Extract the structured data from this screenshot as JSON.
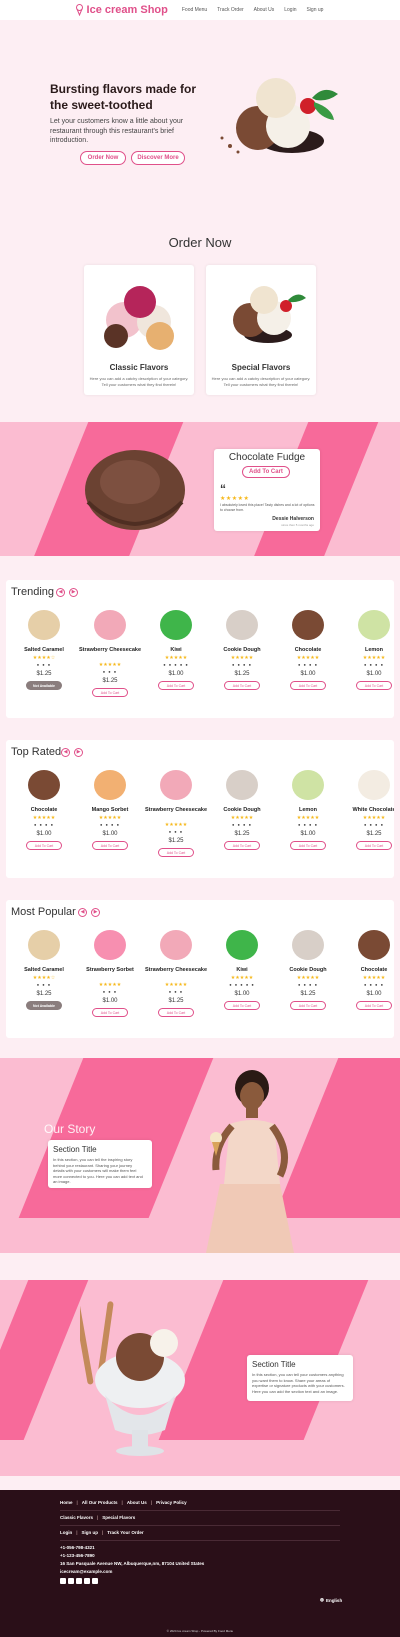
{
  "header": {
    "brand": "Ice cream Shop",
    "nav": [
      "Food Menu",
      "Track Order",
      "About Us",
      "Login",
      "Sign up"
    ]
  },
  "hero": {
    "title": "Bursting flavors made for the sweet-toothed",
    "subtitle": "Let your customers know a little about your restaurant through this restaurant's brief introduction.",
    "order_btn": "Order Now",
    "discover_btn": "Discover More"
  },
  "order_section": {
    "title": "Order Now",
    "cards": [
      {
        "title": "Classic Flavors",
        "desc": "Here you can add a catchy description of your category. Tell your customers what they find therein!"
      },
      {
        "title": "Special Flavors",
        "desc": "Here you can add a catchy description of your category. Tell your customers what they find therein!"
      }
    ]
  },
  "featured": {
    "title": "Chocolate Fudge",
    "button": "Add To Cart",
    "quote_mark": "“",
    "stars": "★★★★★",
    "rating": 5,
    "review": "I absolutely loved this place! Tasty dishes and a lot of options to choose from.",
    "reviewer": "Dessie Halverson",
    "time": "since then 5 months ago"
  },
  "sections": [
    {
      "title": "Trending",
      "items": [
        {
          "name": "Salted Caramel",
          "stars": "★★★★☆",
          "icons": "● ● ●",
          "price": "$1.25",
          "button": "Not Available",
          "available": false,
          "color": "#e6cfa8"
        },
        {
          "name": "Strawberry Cheesecake",
          "stars": "★★★★★",
          "icons": "● ● ●",
          "price": "$1.25",
          "button": "Add To Cart",
          "available": true,
          "color": "#f2a9b8"
        },
        {
          "name": "Kiwi",
          "stars": "★★★★★",
          "icons": "● ● ● ● ●",
          "price": "$1.00",
          "button": "Add To Cart",
          "available": true,
          "color": "#3fb54a"
        },
        {
          "name": "Cookie Dough",
          "stars": "★★★★★",
          "icons": "● ● ● ●",
          "price": "$1.25",
          "button": "Add To Cart",
          "available": true,
          "color": "#d8cfc8"
        },
        {
          "name": "Chocolate",
          "stars": "★★★★★",
          "icons": "● ● ● ●",
          "price": "$1.00",
          "button": "Add To Cart",
          "available": true,
          "color": "#7a4a34"
        },
        {
          "name": "Lemon",
          "stars": "★★★★★",
          "icons": "● ● ● ●",
          "price": "$1.00",
          "button": "Add To Cart",
          "available": true,
          "color": "#cfe3a4"
        }
      ]
    },
    {
      "title": "Top Rated",
      "items": [
        {
          "name": "Chocolate",
          "stars": "★★★★★",
          "icons": "● ● ● ●",
          "price": "$1.00",
          "button": "Add To Cart",
          "available": true,
          "color": "#7a4a34"
        },
        {
          "name": "Mango Sorbet",
          "stars": "★★★★★",
          "icons": "● ● ● ●",
          "price": "$1.00",
          "button": "Add To Cart",
          "available": true,
          "color": "#f2b072"
        },
        {
          "name": "Strawberry Cheesecake",
          "stars": "★★★★★",
          "icons": "● ● ●",
          "price": "$1.25",
          "button": "Add To Cart",
          "available": true,
          "color": "#f2a9b8"
        },
        {
          "name": "Cookie Dough",
          "stars": "★★★★★",
          "icons": "● ● ● ●",
          "price": "$1.25",
          "button": "Add To Cart",
          "available": true,
          "color": "#d8cfc8"
        },
        {
          "name": "Lemon",
          "stars": "★★★★★",
          "icons": "● ● ● ●",
          "price": "$1.00",
          "button": "Add To Cart",
          "available": true,
          "color": "#cfe3a4"
        },
        {
          "name": "White Chocolate",
          "stars": "★★★★★",
          "icons": "● ● ● ●",
          "price": "$1.25",
          "button": "Add To Cart",
          "available": true,
          "color": "#f3ece2"
        }
      ]
    },
    {
      "title": "Most Popular",
      "items": [
        {
          "name": "Salted Caramel",
          "stars": "★★★★☆",
          "icons": "● ● ●",
          "price": "$1.25",
          "button": "Not Available",
          "available": false,
          "color": "#e6cfa8"
        },
        {
          "name": "Strawberry Sorbet",
          "stars": "★★★★★",
          "icons": "● ● ●",
          "price": "$1.00",
          "button": "Add To Cart",
          "available": true,
          "color": "#f78fb0"
        },
        {
          "name": "Strawberry Cheesecake",
          "stars": "★★★★★",
          "icons": "● ● ●",
          "price": "$1.25",
          "button": "Add To Cart",
          "available": true,
          "color": "#f2a9b8"
        },
        {
          "name": "Kiwi",
          "stars": "★★★★★",
          "icons": "● ● ● ● ●",
          "price": "$1.00",
          "button": "Add To Cart",
          "available": true,
          "color": "#3fb54a"
        },
        {
          "name": "Cookie Dough",
          "stars": "★★★★★",
          "icons": "● ● ● ●",
          "price": "$1.25",
          "button": "Add To Cart",
          "available": true,
          "color": "#d8cfc8"
        },
        {
          "name": "Chocolate",
          "stars": "★★★★★",
          "icons": "● ● ● ●",
          "price": "$1.00",
          "button": "Add To Cart",
          "available": true,
          "color": "#7a4a34"
        }
      ]
    }
  ],
  "story": {
    "heading": "Our Story",
    "card_title": "Section Title",
    "card_body": "In this section, you can tell the inspiring story behind your restaurant. Sharing your journey details with your customers will make them feel more connected to you. Here you can add text and an image."
  },
  "section2": {
    "card_title": "Section Title",
    "card_body": "In this section, you can tell your customers anything you want them to know. Share your areas of expertise or signature products with your customers. Here you can add the section text and an image."
  },
  "footer": {
    "links1": [
      "Home",
      "All Our Products",
      "About Us",
      "Privacy Policy"
    ],
    "links2": [
      "Classic Flavors",
      "Special Flavors"
    ],
    "links3": [
      "Login",
      "Sign up",
      "Track Your Order"
    ],
    "phone1": "+1-056-798-4321",
    "phone2": "+1-123-456-7890",
    "address": "16 San Pasquale Avenue NW, Albuquerque,nm, 87104 United States",
    "email": "icecream@example.com",
    "language": "English",
    "copyright": "© 2024 Ice cream Shop - Powered By Food Menu"
  },
  "colors": {
    "accent": "#e0508a",
    "stripe": "#f76a9a",
    "band": "#fbbcd1",
    "page": "#fdeef3",
    "footer": "#2a0f18"
  }
}
